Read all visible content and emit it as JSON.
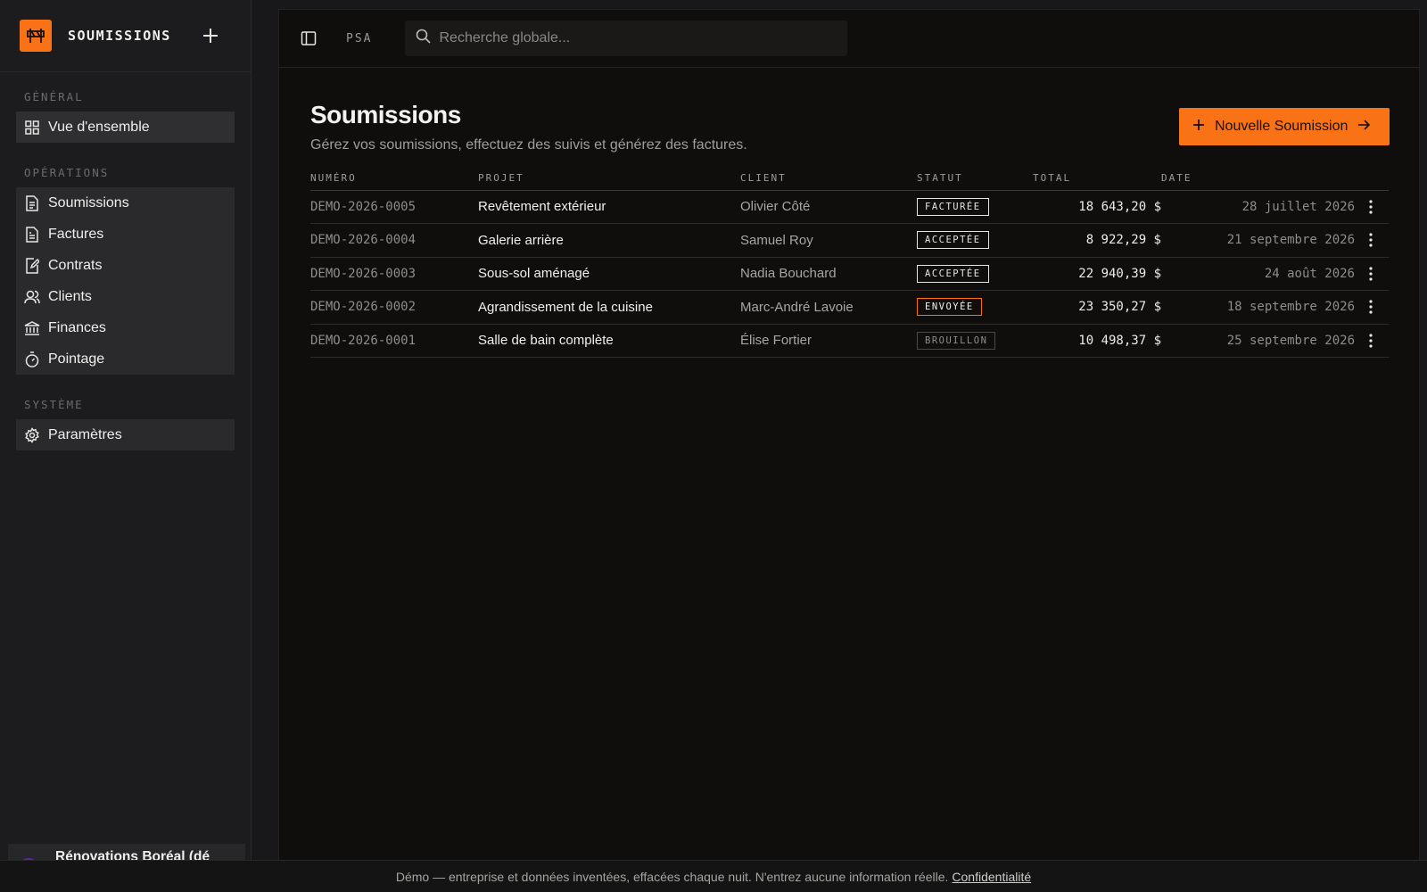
{
  "app": {
    "name": "SOUMISSIONS"
  },
  "sidebar": {
    "sections": [
      {
        "title": "GÉNÉRAL",
        "items": [
          {
            "label": "Vue d'ensemble",
            "icon": "dashboard-icon"
          }
        ]
      },
      {
        "title": "OPÉRATIONS",
        "items": [
          {
            "label": "Soumissions",
            "icon": "document-icon"
          },
          {
            "label": "Factures",
            "icon": "invoice-icon"
          },
          {
            "label": "Contrats",
            "icon": "contract-icon"
          },
          {
            "label": "Clients",
            "icon": "users-icon"
          },
          {
            "label": "Finances",
            "icon": "bank-icon"
          },
          {
            "label": "Pointage",
            "icon": "timer-icon"
          }
        ]
      },
      {
        "title": "SYSTÈME",
        "items": [
          {
            "label": "Paramètres",
            "icon": "gear-icon"
          }
        ]
      }
    ],
    "org_name": "Rénovations Boréal (dé"
  },
  "topbar": {
    "psa_label": "PSA",
    "search_placeholder": "Recherche globale..."
  },
  "page": {
    "title": "Soumissions",
    "subtitle": "Gérez vos soumissions, effectuez des suivis et générez des factures.",
    "new_button": "Nouvelle Soumission"
  },
  "table": {
    "columns": [
      "NUMÉRO",
      "PROJET",
      "CLIENT",
      "STATUT",
      "TOTAL",
      "DATE"
    ],
    "rows": [
      {
        "numero": "DEMO-2026-0005",
        "projet": "Revêtement extérieur",
        "client": "Olivier Côté",
        "statut": "FACTURÉE",
        "total": "18 643,20 $",
        "date": "28 juillet 2026"
      },
      {
        "numero": "DEMO-2026-0004",
        "projet": "Galerie arrière",
        "client": "Samuel Roy",
        "statut": "ACCEPTÉE",
        "total": "8 922,29 $",
        "date": "21 septembre 2026"
      },
      {
        "numero": "DEMO-2026-0003",
        "projet": "Sous-sol aménagé",
        "client": "Nadia Bouchard",
        "statut": "ACCEPTÉE",
        "total": "22 940,39 $",
        "date": "24 août 2026"
      },
      {
        "numero": "DEMO-2026-0002",
        "projet": "Agrandissement de la cuisine",
        "client": "Marc-André Lavoie",
        "statut": "ENVOYÉE",
        "total": "23 350,27 $",
        "date": "18 septembre 2026"
      },
      {
        "numero": "DEMO-2026-0001",
        "projet": "Salle de bain complète",
        "client": "Élise Fortier",
        "statut": "BROUILLON",
        "total": "10 498,37 $",
        "date": "25 septembre 2026"
      }
    ]
  },
  "footer": {
    "text": "Démo — entreprise et données inventées, effacées chaque nuit. N'entrez aucune information réelle.",
    "link": "Confidentialité"
  },
  "colors": {
    "accent": "#f97316",
    "background": "#0f0e0d",
    "sidebar": "#1c1c1f"
  }
}
